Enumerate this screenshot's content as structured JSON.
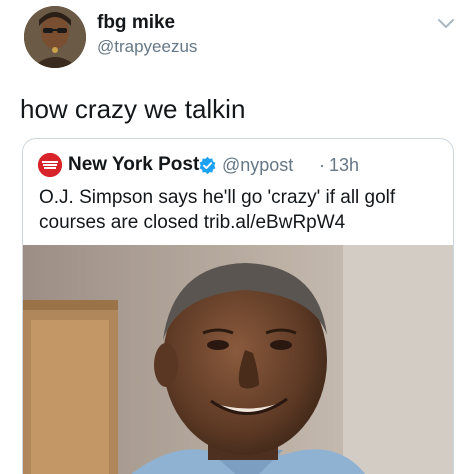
{
  "tweet": {
    "display_name": "fbg mike",
    "handle": "@trapyeezus",
    "text": "how crazy we talkin"
  },
  "quote": {
    "display_name": "New York Post",
    "handle": "@nypost",
    "separator": "·",
    "time": "13h",
    "text_line1": "O.J. Simpson says he'll go 'crazy' if all golf",
    "text_line2": "courses are closed trib.al/eBwRpW4",
    "logo_text": "NEW YORK POST"
  },
  "icons": {
    "menu": "chevron-down-icon",
    "verified": "verified-badge-icon"
  },
  "colors": {
    "text_primary": "#14171a",
    "text_secondary": "#657786",
    "verified_blue": "#1da1f2",
    "nyp_red": "#d9232a",
    "card_border": "#cdd6dd"
  }
}
